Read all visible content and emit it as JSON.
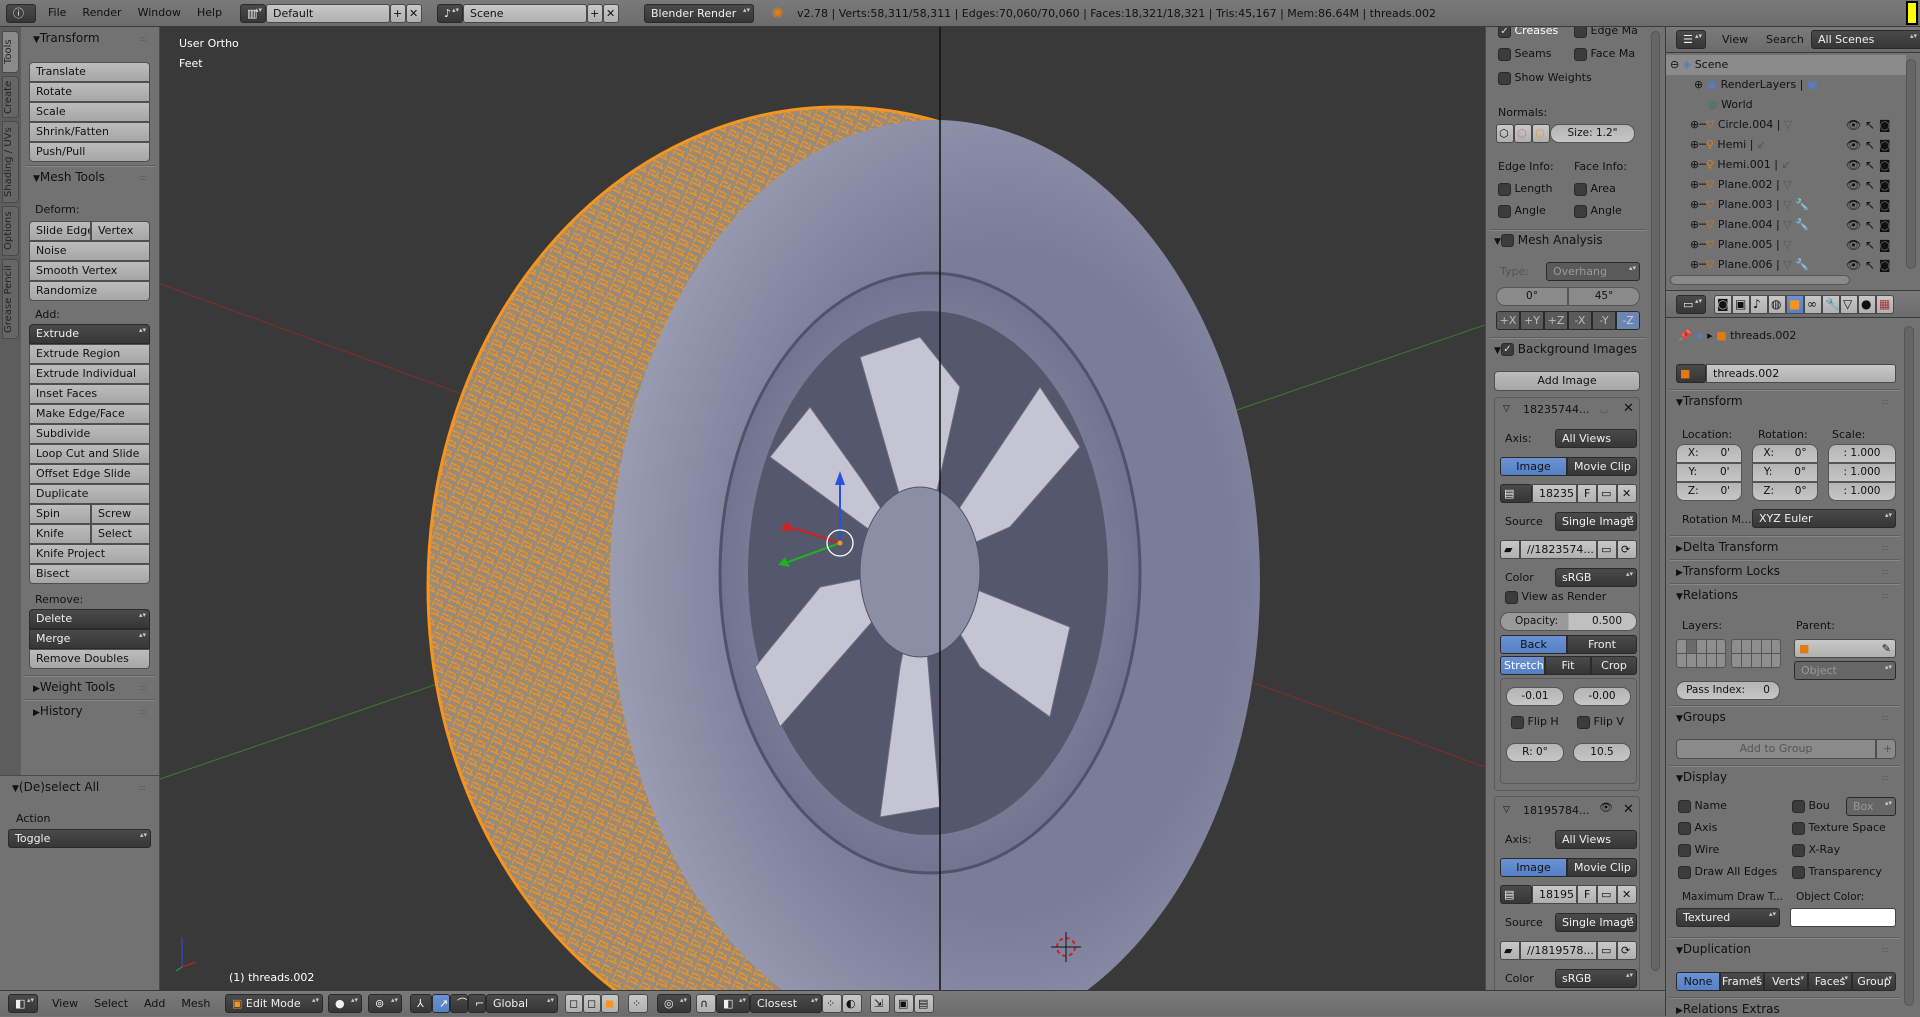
{
  "top_header": {
    "menus": [
      "File",
      "Render",
      "Window",
      "Help"
    ],
    "layout": "Default",
    "scene": "Scene",
    "engine": "Blender Render",
    "stats": "v2.78 | Verts:58,311/58,311 | Edges:70,060/70,060 | Faces:18,321/18,321 | Tris:45,167 | Mem:86.64M | threads.002"
  },
  "tool_tabs": [
    "Tools",
    "Create",
    "Shading / UVs",
    "Options",
    "Grease Pencil"
  ],
  "toolshelf": {
    "transform": {
      "title": "Transform",
      "buttons": [
        "Translate",
        "Rotate",
        "Scale",
        "Shrink/Fatten",
        "Push/Pull"
      ]
    },
    "mesh_tools": {
      "title": "Mesh Tools",
      "deform_label": "Deform:",
      "slide_edge": "Slide Edge",
      "vertex": "Vertex",
      "noise": "Noise",
      "smooth_vertex": "Smooth Vertex",
      "randomize": "Randomize",
      "add_label": "Add:",
      "extrude": "Extrude",
      "add_buttons": [
        "Extrude Region",
        "Extrude Individual",
        "Inset Faces",
        "Make Edge/Face",
        "Subdivide",
        "Loop Cut and Slide",
        "Offset Edge Slide",
        "Duplicate"
      ],
      "spin": "Spin",
      "screw": "Screw",
      "knife": "Knife",
      "select": "Select",
      "knife_project": "Knife Project",
      "bisect": "Bisect",
      "remove_label": "Remove:",
      "delete": "Delete",
      "merge": "Merge",
      "remove_doubles": "Remove Doubles"
    },
    "weight_tools": "Weight Tools",
    "history": "History"
  },
  "operator": {
    "title": "(De)select All",
    "action_label": "Action",
    "action_value": "Toggle"
  },
  "viewport": {
    "view_name": "User Ortho",
    "units": "Feet",
    "object_label": "(1) threads.002"
  },
  "bottom_header": {
    "menus": [
      "View",
      "Select",
      "Add",
      "Mesh"
    ],
    "mode": "Edit Mode",
    "orientation": "Global",
    "snap": "Closest"
  },
  "n_panel": {
    "creases": "Creases",
    "edge_ma": "Edge Ma",
    "seams": "Seams",
    "face_ma": "Face Ma",
    "show_weights": "Show Weights",
    "normals_label": "Normals:",
    "size": "Size:",
    "size_value": "1.2\"",
    "edge_info": "Edge Info:",
    "face_info": "Face Info:",
    "length": "Length",
    "area": "Area",
    "angle1": "Angle",
    "angle2": "Angle",
    "mesh_analysis": "Mesh Analysis",
    "type_label": "Type:",
    "type_value": "Overhang",
    "min": "0°",
    "max": "45°",
    "axes": [
      "+X",
      "+Y",
      "+Z",
      "-X",
      "-Y",
      "-Z"
    ],
    "background_images": "Background Images",
    "add_image": "Add Image",
    "images": [
      {
        "name": "18235744...",
        "axis_label": "Axis:",
        "axis": "All Views",
        "image": "Image",
        "movie_clip": "Movie Clip",
        "id": "18235",
        "f": "F",
        "source_label": "Source",
        "source": "Single Image",
        "path": "//1823574...",
        "color_label": "Color",
        "color": "sRGB",
        "view_as_render": "View as Render",
        "opacity_label": "Opacity:",
        "opacity": "0.500",
        "back": "Back",
        "front": "Front",
        "stretch": "Stretch",
        "fit": "Fit",
        "crop": "Crop",
        "offset_x": "-0.01",
        "offset_y": "-0.00",
        "flip_h": "Flip H",
        "flip_v": "Flip V",
        "rotation": "R: 0°",
        "size": "10.5"
      },
      {
        "name": "18195784...",
        "axis_label": "Axis:",
        "axis": "All Views",
        "image": "Image",
        "movie_clip": "Movie Clip",
        "id": "18195",
        "f": "F",
        "source_label": "Source",
        "source": "Single Image",
        "path": "//1819578...",
        "color_label": "Color",
        "color": "sRGB"
      }
    ]
  },
  "outliner": {
    "view": "View",
    "search": "Search",
    "filter": "All Scenes",
    "rows": [
      "Scene",
      "RenderLayers",
      "World",
      "Circle.004",
      "Hemi",
      "Hemi.001",
      "Plane.002",
      "Plane.003",
      "Plane.004",
      "Plane.005",
      "Plane.006"
    ]
  },
  "properties": {
    "breadcrumb": "threads.002",
    "object_name": "threads.002",
    "transform": "Transform",
    "location": "Location:",
    "rotation": "Rotation:",
    "scale": "Scale:",
    "loc": [
      "X:",
      "0'",
      "Y:",
      "0'",
      "Z:",
      "0'"
    ],
    "rot": [
      "X:",
      "0°",
      "Y:",
      "0°",
      "Z:",
      "0°"
    ],
    "scl": [
      ": 1.000",
      ": 1.000",
      ": 1.000"
    ],
    "rotation_mode_label": "Rotation M...",
    "rotation_mode": "XYZ Euler",
    "delta_transform": "Delta Transform",
    "transform_locks": "Transform Locks",
    "relations": "Relations",
    "layers": "Layers:",
    "parent": "Parent:",
    "parent_type": "Object",
    "pass_index": "Pass Index:",
    "pass_index_value": "0",
    "groups": "Groups",
    "add_to_group": "Add to Group",
    "display": "Display",
    "name": "Name",
    "bou": "Bou",
    "box": "Box",
    "axis": "Axis",
    "texture_space": "Texture Space",
    "wire": "Wire",
    "xray": "X-Ray",
    "draw_all_edges": "Draw All Edges",
    "transparency": "Transparency",
    "max_draw_type_label": "Maximum Draw T...",
    "max_draw_type": "Textured",
    "object_color_label": "Object Color:",
    "object_color": "#ffffff",
    "duplication": "Duplication",
    "dup_options": [
      "None",
      "Frames",
      "Verts",
      "Faces",
      "Group"
    ],
    "relations_extras": "Relations Extras"
  },
  "colors": {
    "selection": "#f5941e",
    "viewport_bg": "#393939",
    "panel_bg": "#727272",
    "accent": "#5680c6"
  }
}
